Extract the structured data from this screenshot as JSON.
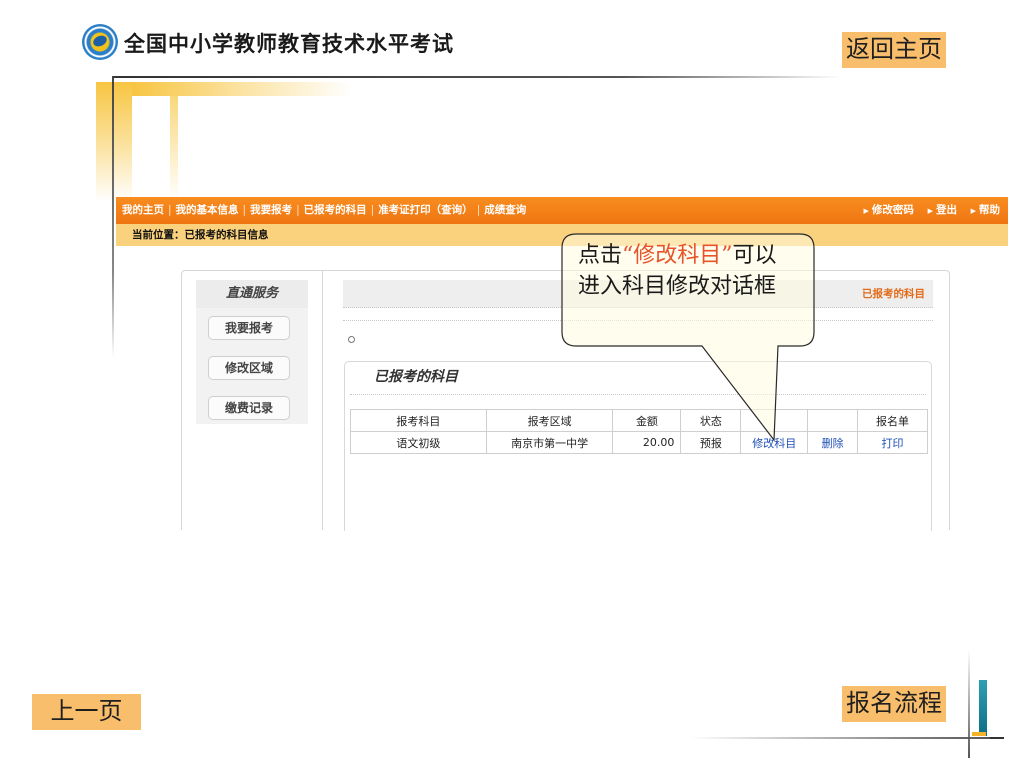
{
  "slide": {
    "title": "全国中小学教师教育技术水平考试",
    "home_button": "返回主页",
    "prev_button": "上一页",
    "flow_button": "报名流程"
  },
  "nav": {
    "items": [
      "我的主页",
      "我的基本信息",
      "我要报考",
      "已报考的科目",
      "准考证打印（查询）",
      "成绩查询"
    ],
    "right": [
      "修改密码",
      "登出",
      "帮助"
    ]
  },
  "location": "当前位置：已报考的科目信息",
  "sidebar": {
    "title": "直通服务",
    "buttons": [
      "我要报考",
      "修改区域",
      "缴费记录"
    ]
  },
  "main": {
    "header_link": "已报考的科目",
    "card_title": "已报考的科目",
    "table": {
      "headers": [
        "报考科目",
        "报考区域",
        "金额",
        "状态",
        "",
        "",
        "报名单"
      ],
      "rows": [
        {
          "subject": "语文初级",
          "region": "南京市第一中学",
          "amount": "20.00",
          "status": "预报",
          "edit": "修改科目",
          "delete": "删除",
          "print": "打印"
        }
      ]
    }
  },
  "callout": {
    "prefix": "点击",
    "highlight": "“修改科目”",
    "suffix": "可以进入科目修改对话框"
  },
  "colors": {
    "nav_orange": "#f07a13",
    "location_yellow": "#fad17c",
    "button_orange": "#f9be6c",
    "highlight_red": "#e8542a",
    "link_blue": "#1e4fb8"
  }
}
